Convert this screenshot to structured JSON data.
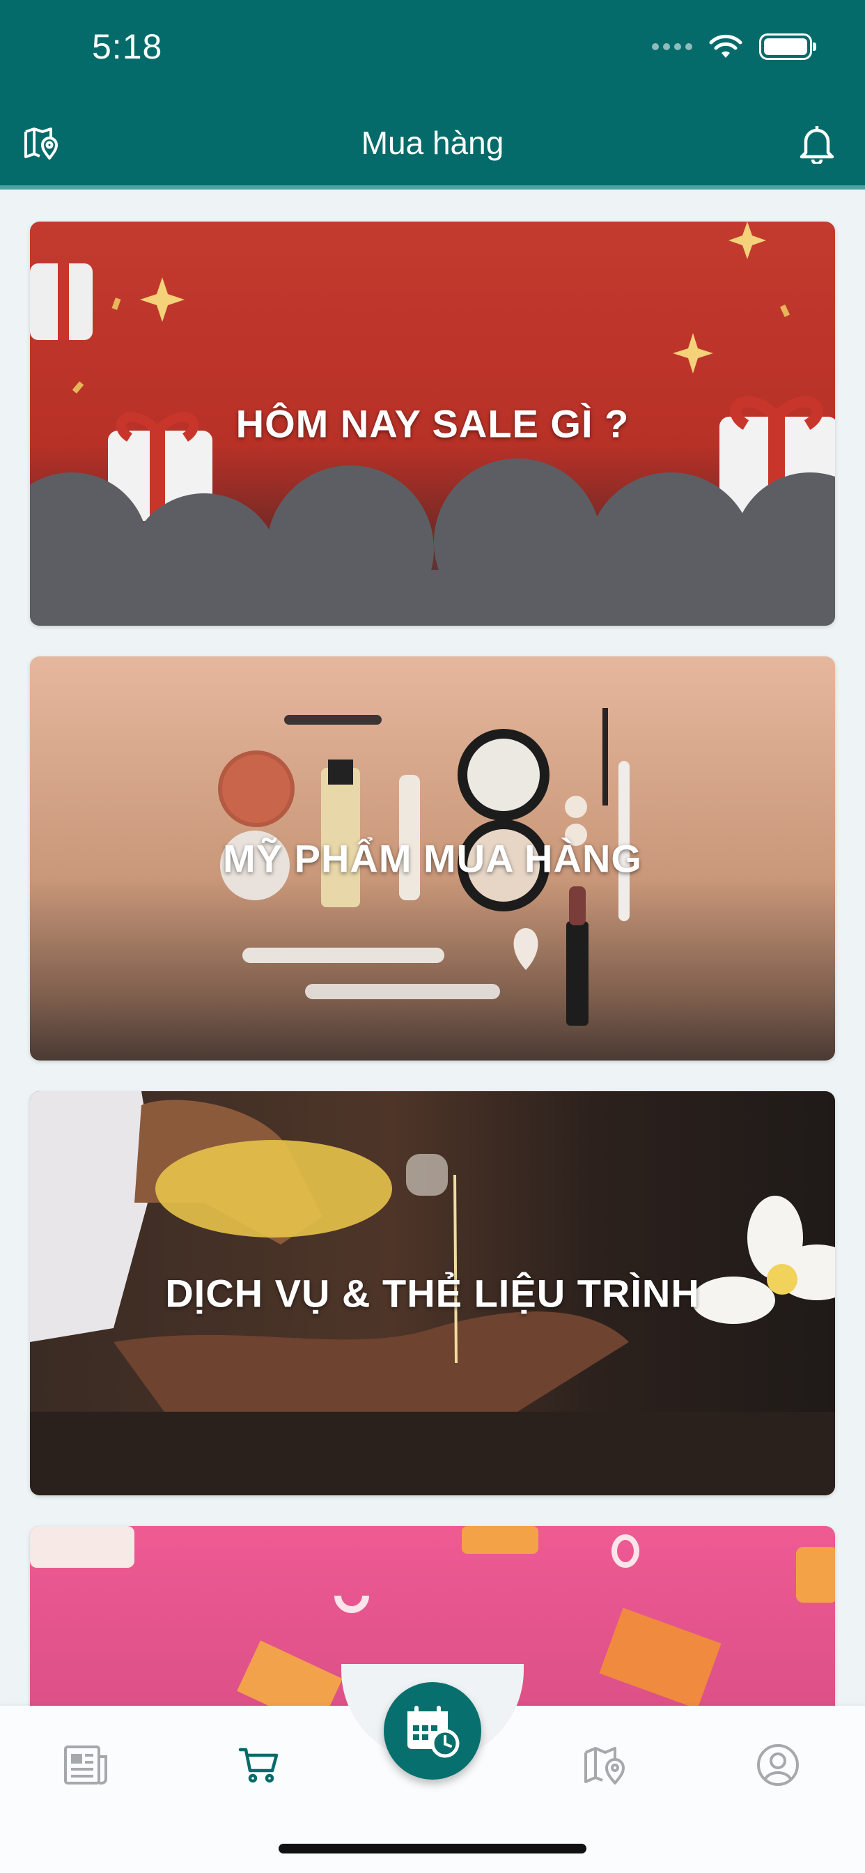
{
  "status_bar": {
    "time": "5:18"
  },
  "header": {
    "title": "Mua hàng",
    "left_icon": "map-pin-icon",
    "right_icon": "bell-icon"
  },
  "cards": [
    {
      "label": "HÔM NAY SALE GÌ ?"
    },
    {
      "label": "MỸ PHẨM MUA HÀNG"
    },
    {
      "label": "DỊCH VỤ & THẺ LIỆU TRÌNH"
    },
    {
      "label": ""
    }
  ],
  "tabbar": {
    "items": [
      {
        "icon": "news-icon",
        "active": false
      },
      {
        "icon": "cart-icon",
        "active": true
      },
      {
        "icon": "calendar-clock-icon",
        "active": false
      },
      {
        "icon": "map-icon",
        "active": false
      },
      {
        "icon": "profile-icon",
        "active": false
      }
    ]
  },
  "colors": {
    "primary": "#056b6a",
    "inactive": "#a5a9ab",
    "background": "#eef3f6"
  }
}
